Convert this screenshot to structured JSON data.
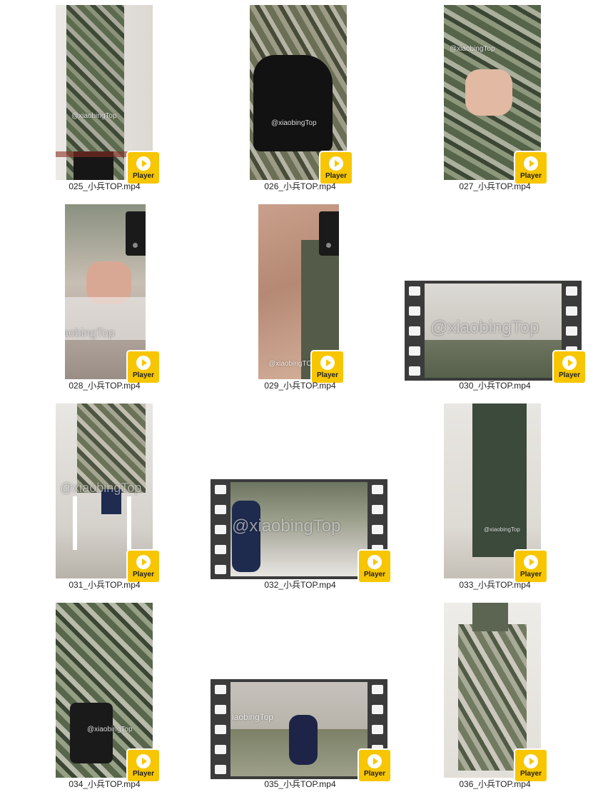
{
  "player_label": "Player",
  "watermark_at": "@xiaobingTop",
  "watermark_plain": "xiaobingTop",
  "watermark_at_upper": "@xiaobingTOP",
  "watermark_partial": "iaobingTop",
  "watermark_partial2": "aobingTop",
  "files": [
    {
      "name": "025_小兵TOP.mp4"
    },
    {
      "name": "026_小兵TOP.mp4"
    },
    {
      "name": "027_小兵TOP.mp4"
    },
    {
      "name": "028_小兵TOP.mp4"
    },
    {
      "name": "029_小兵TOP.mp4"
    },
    {
      "name": "030_小兵TOP.mp4"
    },
    {
      "name": "031_小兵TOP.mp4"
    },
    {
      "name": "032_小兵TOP.mp4"
    },
    {
      "name": "033_小兵TOP.mp4"
    },
    {
      "name": "034_小兵TOP.mp4"
    },
    {
      "name": "035_小兵TOP.mp4"
    },
    {
      "name": "036_小兵TOP.mp4"
    }
  ]
}
